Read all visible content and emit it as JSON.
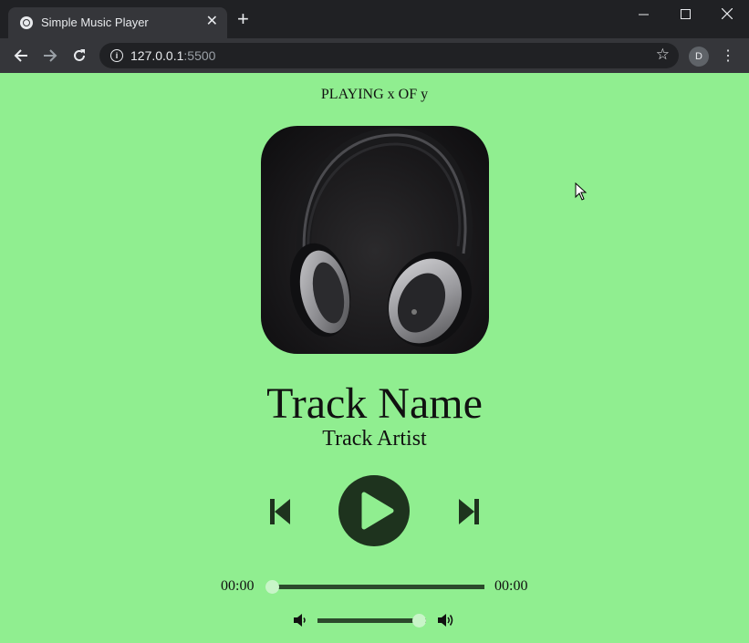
{
  "browser": {
    "tab_title": "Simple Music Player",
    "url_host": "127.0.0.1",
    "url_port": ":5500",
    "profile_initial": "D"
  },
  "player": {
    "now_playing": "PLAYING x OF y",
    "track_name": "Track Name",
    "track_artist": "Track Artist",
    "current_time": "00:00",
    "total_duration": "00:00",
    "seek_fraction": 0.0,
    "volume_fraction": 0.93,
    "album_art": "headphones-photo"
  },
  "colors": {
    "background": "#90ee90",
    "controls": "#1e331e",
    "slider_track": "#2c4a2c",
    "slider_thumb": "#c8f5c8"
  }
}
